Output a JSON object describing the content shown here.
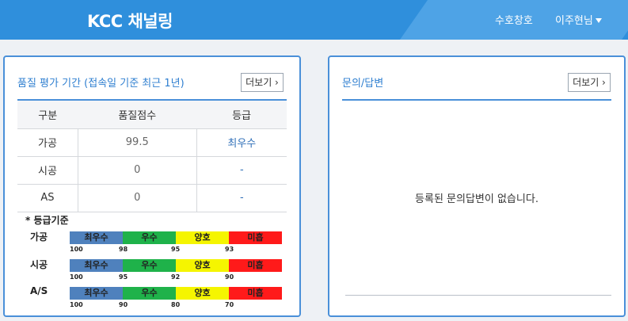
{
  "header": {
    "logo": "KCC 채널링",
    "nav": [
      "수호창호",
      "이주현님"
    ]
  },
  "quality": {
    "title": "품질 평가 기간 (접속일 기준 최근 1년)",
    "more_label": "더보기 ›",
    "columns": [
      "구분",
      "품질점수",
      "등급"
    ],
    "rows": [
      {
        "label": "가공",
        "score": "99.5",
        "grade": "최우수"
      },
      {
        "label": "시공",
        "score": "0",
        "grade": "-"
      },
      {
        "label": "AS",
        "score": "0",
        "grade": "-"
      }
    ],
    "legend_title": "* 등급기준",
    "segment_labels": [
      "최우수",
      "우수",
      "양호",
      "미흡"
    ],
    "segment_colors": [
      "#4f81bd",
      "#1fb24a",
      "#f5f500",
      "#ff1a1a"
    ],
    "legend_rows": [
      {
        "label": "가공",
        "ticks": [
          "100",
          "98",
          "95",
          "93"
        ]
      },
      {
        "label": "시공",
        "ticks": [
          "100",
          "95",
          "92",
          "90"
        ]
      },
      {
        "label": "A/S",
        "ticks": [
          "100",
          "90",
          "80",
          "70"
        ]
      }
    ]
  },
  "inquiry": {
    "title": "문의/답변",
    "more_label": "더보기 ›",
    "empty_message": "등록된 문의답변이 없습니다."
  }
}
